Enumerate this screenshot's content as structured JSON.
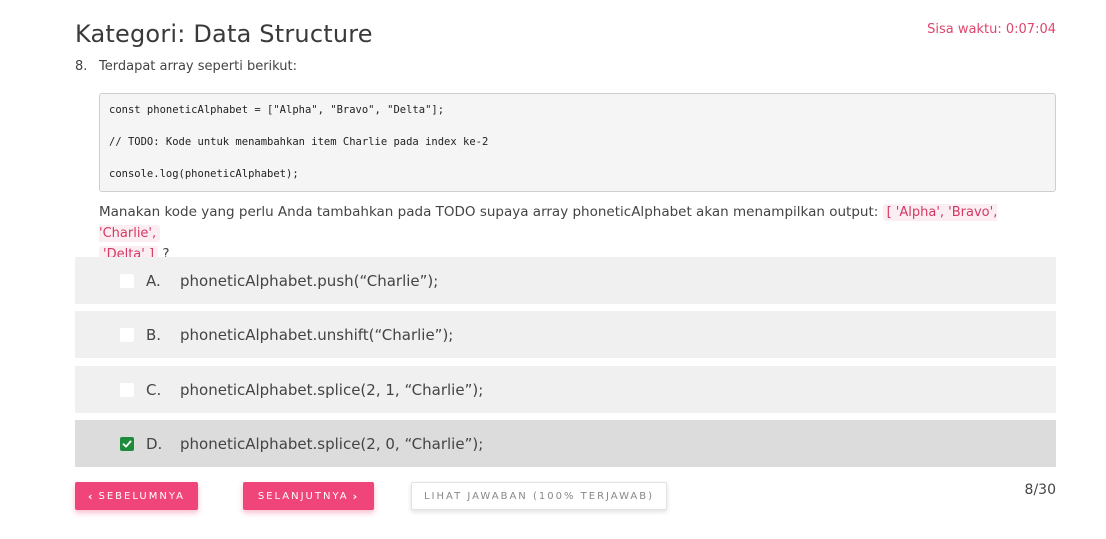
{
  "header": {
    "title": "Kategori: Data Structure",
    "timer": "Sisa waktu: 0:07:04"
  },
  "question": {
    "number": "8.",
    "intro": "Terdapat array seperti berikut:",
    "code": [
      "const phoneticAlphabet = [\"Alpha\", \"Bravo\", \"Delta\"];",
      "// TODO: Kode untuk menambahkan item Charlie pada index ke-2",
      "console.log(phoneticAlphabet);"
    ],
    "prompt_before": "Manakan kode yang perlu Anda tambahkan pada TODO supaya array phoneticAlphabet akan menampilkan output: ",
    "prompt_output_line1": "[ 'Alpha', 'Bravo', 'Charlie',",
    "prompt_output_line2": "'Delta' ]",
    "prompt_after": " ?"
  },
  "options": [
    {
      "letter": "A.",
      "text": "phoneticAlphabet.push(“Charlie”);",
      "checked": false
    },
    {
      "letter": "B.",
      "text": "phoneticAlphabet.unshift(“Charlie”);",
      "checked": false
    },
    {
      "letter": "C.",
      "text": "phoneticAlphabet.splice(2, 1, “Charlie”);",
      "checked": false
    },
    {
      "letter": "D.",
      "text": "phoneticAlphabet.splice(2, 0, “Charlie”);",
      "checked": true
    }
  ],
  "navigation": {
    "prev_label": "Sebelumnya",
    "next_label": "Selanjutnya",
    "answers_label": "Lihat Jawaban (100% Terjawab)",
    "page_counter": "8/30"
  },
  "colors": {
    "accent": "#f0457a",
    "timer": "#e0456b",
    "check": "#1e8c3a"
  },
  "icons": {
    "prev": "chevron-left-icon",
    "next": "chevron-right-icon",
    "check": "checkmark-icon"
  }
}
